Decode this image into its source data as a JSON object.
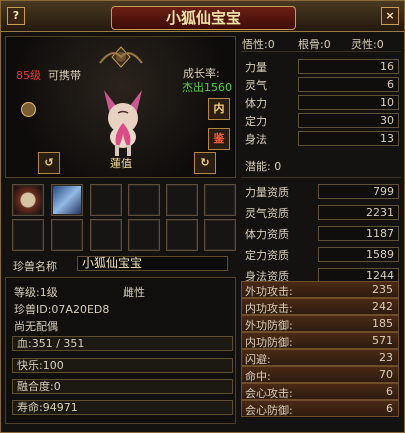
{
  "window": {
    "title": "小狐仙宝宝",
    "help_label": "?",
    "close_label": "×"
  },
  "pet": {
    "level": "85级",
    "carry": "可携带",
    "growth_label": "成长率:",
    "growth_value": "杰出1560",
    "internal_button": "内",
    "appraise_button": "鉴",
    "status": "蓮值",
    "left_arrow": "↺",
    "right_arrow": "↻"
  },
  "skills": {
    "skill_1_name": "skill",
    "skill_2_name": "blade"
  },
  "name_row": {
    "label": "珍兽名称",
    "value": "小狐仙宝宝"
  },
  "info": {
    "level_line": "等级:1级",
    "gender": "雌性",
    "pet_id": "珍兽ID:07A20ED8",
    "spouse": "尚无配偶",
    "blood": "血:351 / 351",
    "joy": "快乐:100",
    "merge": "融合度:0",
    "life": "寿命:94971"
  },
  "top_stats": {
    "savvy": "悟性:0",
    "bones": "根骨:0",
    "spirit": "灵性:0"
  },
  "base_stats": [
    {
      "label": "力量",
      "value": "16"
    },
    {
      "label": "灵气",
      "value": "6"
    },
    {
      "label": "体力",
      "value": "10"
    },
    {
      "label": "定力",
      "value": "30"
    },
    {
      "label": "身法",
      "value": "13"
    }
  ],
  "potential": "潜能: 0",
  "aptitude_stats": [
    {
      "label": "力量资质",
      "value": "799"
    },
    {
      "label": "灵气资质",
      "value": "2231"
    },
    {
      "label": "体力资质",
      "value": "1187"
    },
    {
      "label": "定力资质",
      "value": "1589"
    },
    {
      "label": "身法资质",
      "value": "1244"
    }
  ],
  "combat_stats": [
    {
      "label": "外功攻击:",
      "value": "235"
    },
    {
      "label": "内功攻击:",
      "value": "242"
    },
    {
      "label": "外功防御:",
      "value": "185"
    },
    {
      "label": "内功防御:",
      "value": "571"
    },
    {
      "label": "闪避:",
      "value": "23"
    },
    {
      "label": "命中:",
      "value": "70"
    },
    {
      "label": "会心攻击:",
      "value": "6"
    },
    {
      "label": "会心防御:",
      "value": "6"
    }
  ]
}
